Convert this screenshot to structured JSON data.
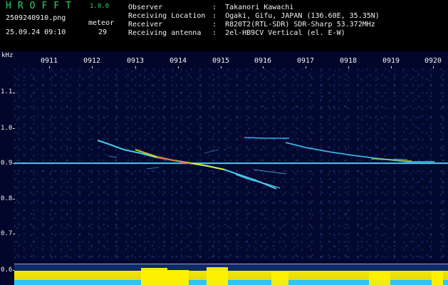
{
  "header": {
    "title": "HROFFT",
    "version": "1.0.0",
    "filename": "2509240910.png",
    "timestamp": "25.09.24 09:10",
    "meteor_label": "meteor",
    "meteor_count": "29",
    "info_rows": [
      {
        "label": "Observer",
        "value": "Takanori Kawachi"
      },
      {
        "label": "Receiving Location",
        "value": "Ogaki, Gifu, JAPAN (136.60E, 35.35N)"
      },
      {
        "label": "Receiver",
        "value": "R820T2(RTL-SDR) SDR-Sharp 53.372MHz"
      },
      {
        "label": "Receiving antenna",
        "value": "2el-HB9CV Vertical (el. E-W)"
      }
    ]
  },
  "axes": {
    "y_unit": "kHz",
    "y_ticks": [
      "1.1",
      "1.0",
      "0.9",
      "0.8",
      "0.7",
      "0.6"
    ],
    "x_ticks": [
      "0911",
      "0912",
      "0913",
      "0914",
      "0915",
      "0916",
      "0917",
      "0918",
      "0919",
      "0920"
    ]
  },
  "colors": {
    "header_green": "#28d46a",
    "background": "#000000",
    "plot_background": "#02062b",
    "signal_cyan": "#39d2ff",
    "signal_yellow": "#fff200"
  }
}
